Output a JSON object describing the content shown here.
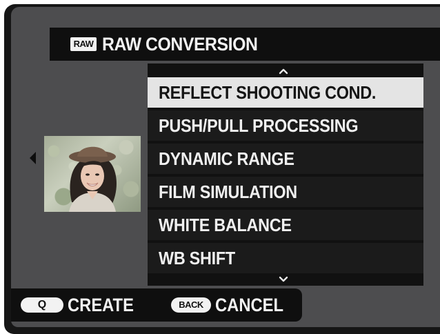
{
  "header": {
    "badge": "RAW",
    "title": "RAW CONVERSION"
  },
  "menu": {
    "items": [
      {
        "label": "REFLECT SHOOTING COND.",
        "selected": true
      },
      {
        "label": "PUSH/PULL PROCESSING",
        "selected": false
      },
      {
        "label": "DYNAMIC RANGE",
        "selected": false
      },
      {
        "label": "FILM SIMULATION",
        "selected": false
      },
      {
        "label": "WHITE BALANCE",
        "selected": false
      },
      {
        "label": "WB SHIFT",
        "selected": false
      }
    ]
  },
  "footer": {
    "create_key": "Q",
    "create_label": "CREATE",
    "cancel_key": "BACK",
    "cancel_label": "CANCEL"
  },
  "icons": {
    "scroll_up": "chevron-up-icon",
    "scroll_down": "chevron-down-icon",
    "previous": "caret-left-icon"
  },
  "colors": {
    "selected_bg": "#e4e4e4",
    "item_bg": "#1b1b1b",
    "screen_bg": "#4d4d4f"
  }
}
